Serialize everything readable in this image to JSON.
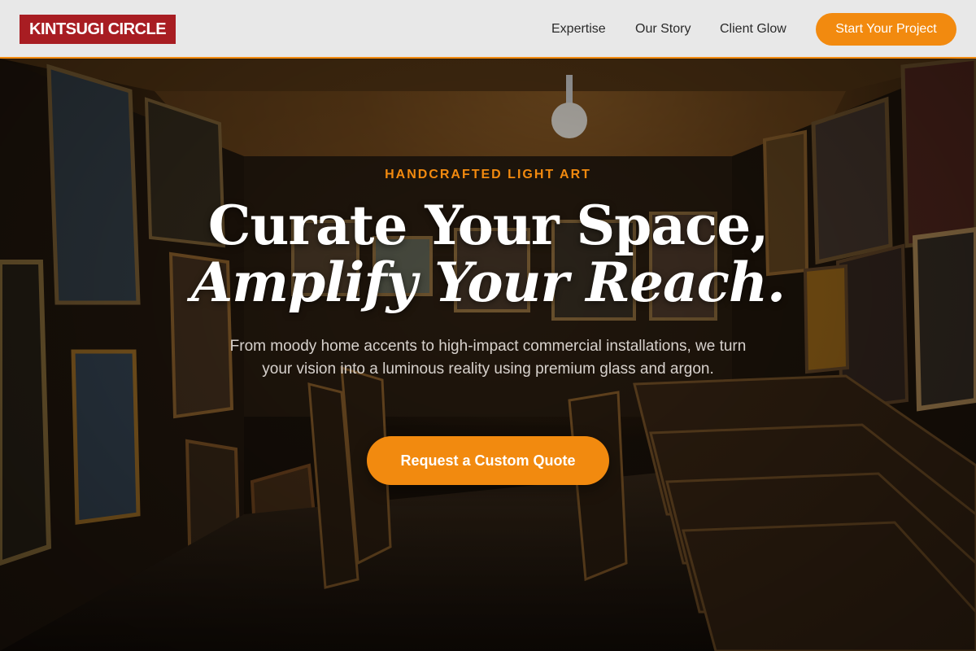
{
  "brand": {
    "logo_text": "KINTSUGI CIRCLE",
    "accent_color": "#f28a0f",
    "logo_bg": "#a81d22"
  },
  "nav": {
    "links": [
      {
        "label": "Expertise"
      },
      {
        "label": "Our Story"
      },
      {
        "label": "Client Glow"
      }
    ],
    "cta_label": "Start Your Project"
  },
  "hero": {
    "eyebrow": "HANDCRAFTED LIGHT ART",
    "headline_line1": "Curate Your Space,",
    "headline_line2": "Amplify Your Reach.",
    "subtext": "From moody home accents to high-impact commercial installations, we turn your vision into a luminous reality using premium glass and argon.",
    "cta_label": "Request a Custom Quote",
    "background_image": "art-gallery-studio-photo"
  }
}
